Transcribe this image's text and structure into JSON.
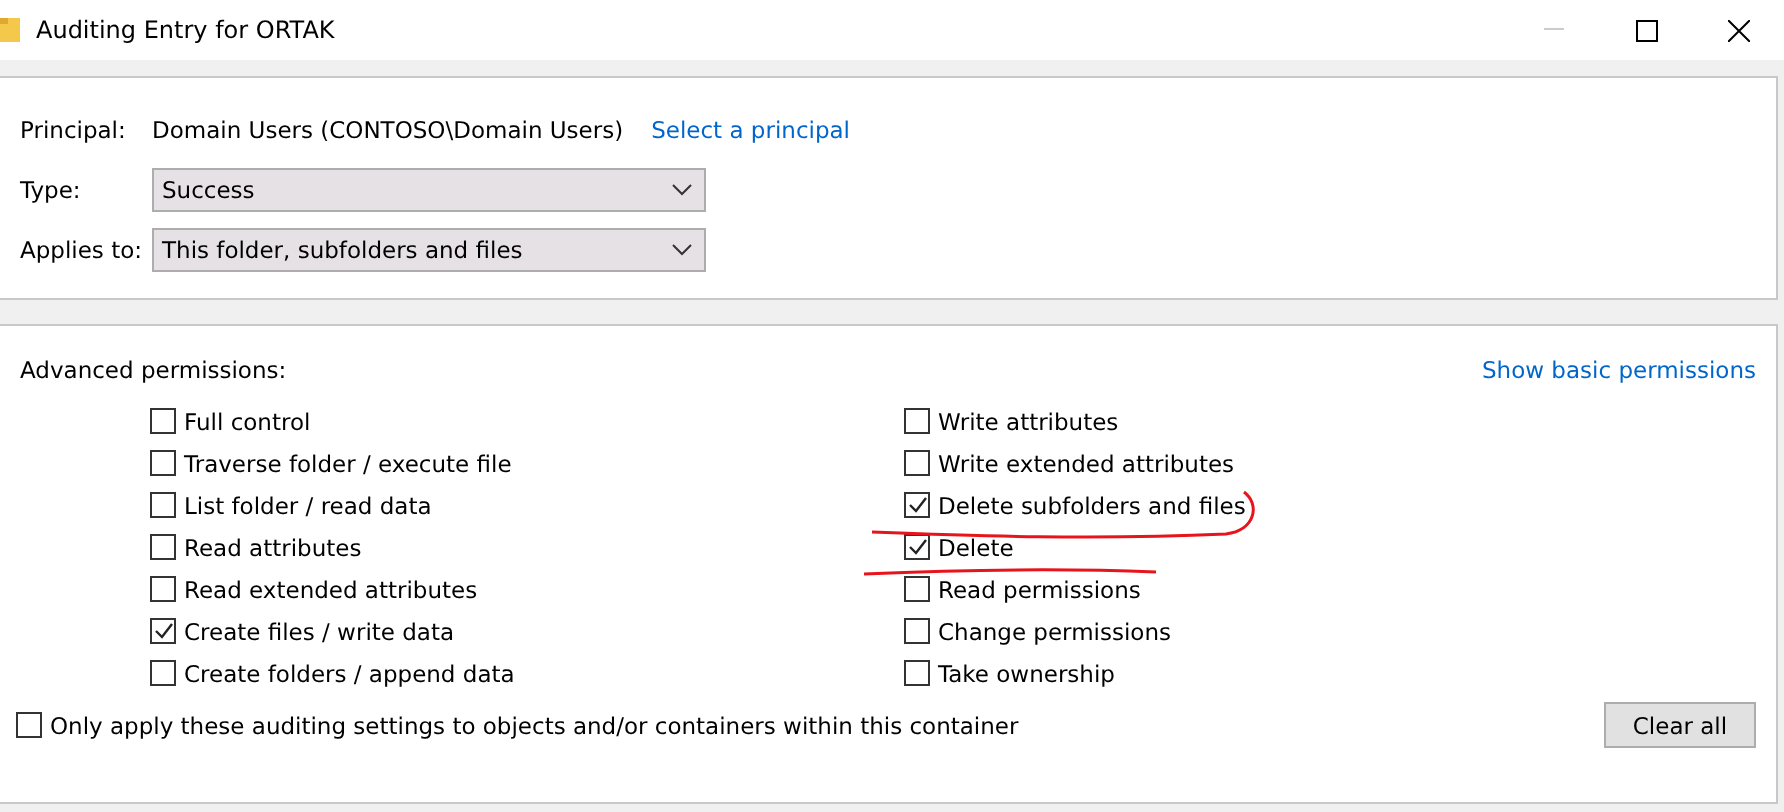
{
  "window": {
    "title": "Auditing Entry for ORTAK"
  },
  "principal": {
    "label": "Principal:",
    "value": "Domain Users (CONTOSO\\Domain Users)",
    "link": "Select a principal"
  },
  "fields": [
    {
      "label": "Type:",
      "value": "Success"
    },
    {
      "label": "Applies to:",
      "value": "This folder, subfolders and files"
    }
  ],
  "advanced": {
    "title": "Advanced permissions:",
    "link": "Show basic permissions",
    "columns": [
      [
        {
          "label": "Full control",
          "checked": false
        },
        {
          "label": "Traverse folder / execute file",
          "checked": false
        },
        {
          "label": "List folder / read data",
          "checked": false
        },
        {
          "label": "Read attributes",
          "checked": false
        },
        {
          "label": "Read extended attributes",
          "checked": false
        },
        {
          "label": "Create files / write data",
          "checked": true
        },
        {
          "label": "Create folders / append data",
          "checked": false
        }
      ],
      [
        {
          "label": "Write attributes",
          "checked": false
        },
        {
          "label": "Write extended attributes",
          "checked": false
        },
        {
          "label": "Delete subfolders and files",
          "checked": true
        },
        {
          "label": "Delete",
          "checked": true
        },
        {
          "label": "Read permissions",
          "checked": false
        },
        {
          "label": "Change permissions",
          "checked": false
        },
        {
          "label": "Take ownership",
          "checked": false
        }
      ]
    ],
    "only_apply": {
      "label": "Only apply these auditing settings to objects and/or containers within this container",
      "checked": false
    },
    "clear_button": "Clear all"
  }
}
